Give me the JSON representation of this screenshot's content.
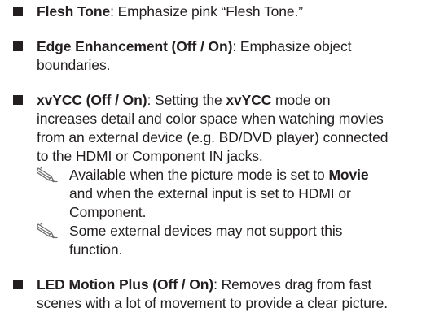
{
  "items": [
    {
      "term": "Flesh Tone",
      "desc": ": Emphasize pink “Flesh Tone.”"
    },
    {
      "term": "Edge Enhancement (Off / On)",
      "desc_line1": ": Emphasize object",
      "desc_line2": "boundaries."
    },
    {
      "term": "xvYCC (Off / On)",
      "desc_a": ": Setting the ",
      "term_inline": "xvYCC",
      "desc_b": " mode on",
      "line2": "increases detail and color space when watching movies",
      "line3": "from an external device (e.g. BD/DVD player) connected",
      "line4": "to the HDMI or Component IN jacks.",
      "notes": [
        {
          "icon": "note-pencil-icon",
          "line1_a": "Available when the picture mode is set to ",
          "line1_bold": "Movie",
          "line2": "and when the external input is set to HDMI or",
          "line3": "Component."
        },
        {
          "icon": "note-pencil-icon",
          "line1": "Some external devices may not support this",
          "line2": "function."
        }
      ]
    },
    {
      "term": "LED Motion Plus (Off / On)",
      "desc_line1": ": Removes drag from fast",
      "desc_line2": "scenes with a lot of movement to provide a clear picture."
    }
  ],
  "colors": {
    "text": "#231f20",
    "icon": "#6d6e70"
  }
}
